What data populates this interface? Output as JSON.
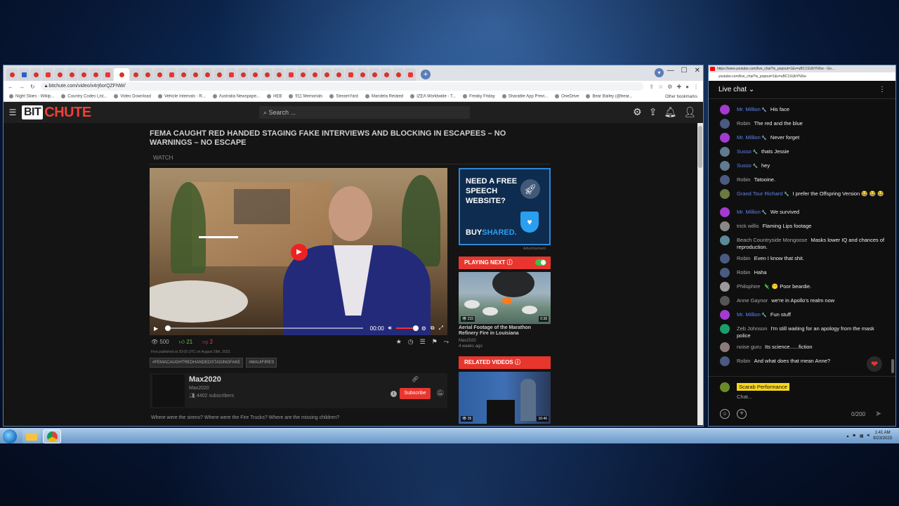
{
  "browser": {
    "url": "bitchute.com/video/x4rj6orQZFNW/",
    "tab_count": 34,
    "bookmarks": [
      "Night Skies - Wikip...",
      "Country Codes List...",
      "Video Download",
      "Vehicle Internals - R...",
      "Australia Newspape...",
      "HEB",
      "911 Memorials",
      "StreamYard",
      "Mandela Related",
      "IZEA Worldwide - T...",
      "Freaky Friday",
      "Sharable App Previ...",
      "OneDrive",
      "Bear Bailey (@bear..."
    ],
    "other_bookmarks": "Other bookmarks"
  },
  "bitchute": {
    "logo_bit": "BIT",
    "logo_chute": "CHUTE",
    "search_placeholder": "Search ...",
    "video_title": "FEMA CAUGHT RED HANDED STAGING FAKE INTERVIEWS AND BLOCKING IN ESCAPEES – NO WARNINGS – NO ESCAPE",
    "watch_tab": "WATCH",
    "player": {
      "time": "00:00",
      "progress": 0.0,
      "volume": 0.85
    },
    "views": "500",
    "likes": "21",
    "dislikes": "2",
    "published": "First published at 20:05 UTC on August 29th, 2023.",
    "hashtags": [
      "#FEMACAUGHTREDHANDEDSTAGINGFAKE",
      "#MAUIFIRES"
    ],
    "channel": {
      "name": "Max2020",
      "handle": "Max2020",
      "subscribers": "4402 subscribers",
      "subscribe_label": "Subscribe"
    },
    "description": "Where were the sirens? Where were the Fire Trucks? Where are the missing children?",
    "ad": {
      "headline": "NEED A FREE SPEECH WEBSITE?",
      "brand_a": "BUY",
      "brand_b": "SHARED.",
      "label": "Advertisement"
    },
    "playing_next_label": "PLAYING NEXT",
    "next_video": {
      "title": "Aerial Footage of the Marathon Refinery Fire in Louisiana",
      "channel": "Max2020",
      "age": "4 weeks ago",
      "views": "215",
      "duration": "0:38"
    },
    "related_label": "RELATED VIDEOS",
    "related_video": {
      "views": "35",
      "duration": "16:46"
    }
  },
  "chat": {
    "window_title": "https://www.youtube.com/live_chat?is_popout=1&v=uBC1SUbYNXw - Go...",
    "url": "youtube.com/live_chat?is_popout=1&v=uBC1SUbYNXw",
    "header": "Live chat",
    "messages": [
      {
        "author": "Mr. Million",
        "mod": true,
        "text": "His face",
        "color": "#a33bd1"
      },
      {
        "author": "Robin",
        "mod": false,
        "text": "The red and the blue",
        "color": "#4a5a80"
      },
      {
        "author": "Mr. Million",
        "mod": true,
        "text": "Never forget",
        "color": "#a33bd1"
      },
      {
        "author": "Susso",
        "mod": true,
        "text": "thats Jessie",
        "color": "#607a90"
      },
      {
        "author": "Susso",
        "mod": true,
        "text": "hey",
        "color": "#607a90"
      },
      {
        "author": "Robin",
        "mod": false,
        "text": "Tatooine.",
        "color": "#4a5a80"
      },
      {
        "author": "Grand Tour Richard",
        "mod": true,
        "text": "I prefer the Offspring Version 😂 😂 😂",
        "color": "#6a7a40"
      },
      {
        "author": "Mr. Million",
        "mod": true,
        "text": "We survived",
        "color": "#a33bd1"
      },
      {
        "author": "trick willis",
        "mod": false,
        "text": "Flaming Lips footage",
        "color": "#888888"
      },
      {
        "author": "Beach Countryside Mongoose",
        "mod": false,
        "text": "Masks lower IQ and chances of reproduction.",
        "color": "#5a8a9a"
      },
      {
        "author": "Robin",
        "mod": false,
        "text": "Even I know that shit.",
        "color": "#4a5a80"
      },
      {
        "author": "Robin",
        "mod": false,
        "text": "Haha",
        "color": "#4a5a80"
      },
      {
        "author": "Philophire",
        "mod": false,
        "text": "🦎 😶 Poor beardie.",
        "color": "#999999"
      },
      {
        "author": "Anne Gaynor",
        "mod": false,
        "text": "we're in Apollo's realm now",
        "color": "#555555"
      },
      {
        "author": "Mr. Million",
        "mod": true,
        "text": "Fun stuff",
        "color": "#a33bd1"
      },
      {
        "author": "Zeb Johnson",
        "mod": false,
        "text": "I'm still waiting for an apology from the mask police",
        "color": "#1a9e6a"
      },
      {
        "author": "noise guru",
        "mod": false,
        "text": "Its science......fiction",
        "color": "#8a7a7a"
      },
      {
        "author": "Robin",
        "mod": false,
        "text": "And what does that mean Anne?",
        "color": "#4a5a80"
      }
    ],
    "me": "Scarab Performance",
    "placeholder": "Chat...",
    "char_count": "0/200"
  },
  "taskbar": {
    "time": "1:41 AM",
    "date": "9/23/2023"
  }
}
